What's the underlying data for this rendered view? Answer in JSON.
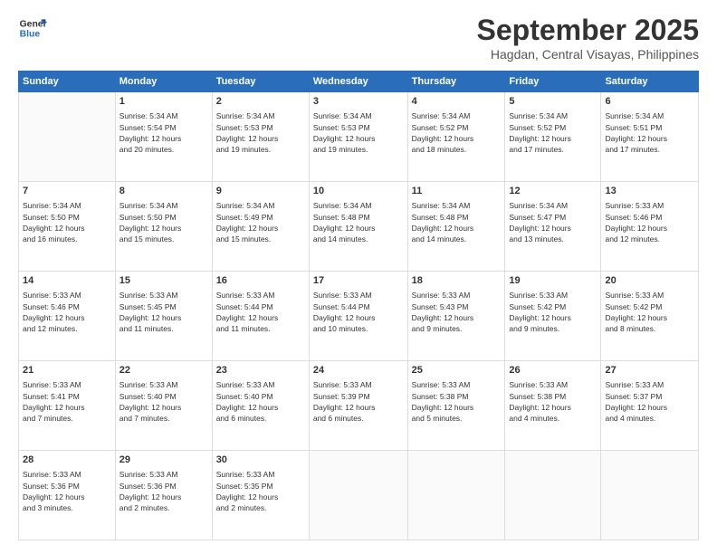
{
  "header": {
    "logo_line1": "General",
    "logo_line2": "Blue",
    "month": "September 2025",
    "location": "Hagdan, Central Visayas, Philippines"
  },
  "days_of_week": [
    "Sunday",
    "Monday",
    "Tuesday",
    "Wednesday",
    "Thursday",
    "Friday",
    "Saturday"
  ],
  "weeks": [
    [
      {
        "day": "",
        "info": ""
      },
      {
        "day": "1",
        "info": "Sunrise: 5:34 AM\nSunset: 5:54 PM\nDaylight: 12 hours\nand 20 minutes."
      },
      {
        "day": "2",
        "info": "Sunrise: 5:34 AM\nSunset: 5:53 PM\nDaylight: 12 hours\nand 19 minutes."
      },
      {
        "day": "3",
        "info": "Sunrise: 5:34 AM\nSunset: 5:53 PM\nDaylight: 12 hours\nand 19 minutes."
      },
      {
        "day": "4",
        "info": "Sunrise: 5:34 AM\nSunset: 5:52 PM\nDaylight: 12 hours\nand 18 minutes."
      },
      {
        "day": "5",
        "info": "Sunrise: 5:34 AM\nSunset: 5:52 PM\nDaylight: 12 hours\nand 17 minutes."
      },
      {
        "day": "6",
        "info": "Sunrise: 5:34 AM\nSunset: 5:51 PM\nDaylight: 12 hours\nand 17 minutes."
      }
    ],
    [
      {
        "day": "7",
        "info": "Sunrise: 5:34 AM\nSunset: 5:50 PM\nDaylight: 12 hours\nand 16 minutes."
      },
      {
        "day": "8",
        "info": "Sunrise: 5:34 AM\nSunset: 5:50 PM\nDaylight: 12 hours\nand 15 minutes."
      },
      {
        "day": "9",
        "info": "Sunrise: 5:34 AM\nSunset: 5:49 PM\nDaylight: 12 hours\nand 15 minutes."
      },
      {
        "day": "10",
        "info": "Sunrise: 5:34 AM\nSunset: 5:48 PM\nDaylight: 12 hours\nand 14 minutes."
      },
      {
        "day": "11",
        "info": "Sunrise: 5:34 AM\nSunset: 5:48 PM\nDaylight: 12 hours\nand 14 minutes."
      },
      {
        "day": "12",
        "info": "Sunrise: 5:34 AM\nSunset: 5:47 PM\nDaylight: 12 hours\nand 13 minutes."
      },
      {
        "day": "13",
        "info": "Sunrise: 5:33 AM\nSunset: 5:46 PM\nDaylight: 12 hours\nand 12 minutes."
      }
    ],
    [
      {
        "day": "14",
        "info": "Sunrise: 5:33 AM\nSunset: 5:46 PM\nDaylight: 12 hours\nand 12 minutes."
      },
      {
        "day": "15",
        "info": "Sunrise: 5:33 AM\nSunset: 5:45 PM\nDaylight: 12 hours\nand 11 minutes."
      },
      {
        "day": "16",
        "info": "Sunrise: 5:33 AM\nSunset: 5:44 PM\nDaylight: 12 hours\nand 11 minutes."
      },
      {
        "day": "17",
        "info": "Sunrise: 5:33 AM\nSunset: 5:44 PM\nDaylight: 12 hours\nand 10 minutes."
      },
      {
        "day": "18",
        "info": "Sunrise: 5:33 AM\nSunset: 5:43 PM\nDaylight: 12 hours\nand 9 minutes."
      },
      {
        "day": "19",
        "info": "Sunrise: 5:33 AM\nSunset: 5:42 PM\nDaylight: 12 hours\nand 9 minutes."
      },
      {
        "day": "20",
        "info": "Sunrise: 5:33 AM\nSunset: 5:42 PM\nDaylight: 12 hours\nand 8 minutes."
      }
    ],
    [
      {
        "day": "21",
        "info": "Sunrise: 5:33 AM\nSunset: 5:41 PM\nDaylight: 12 hours\nand 7 minutes."
      },
      {
        "day": "22",
        "info": "Sunrise: 5:33 AM\nSunset: 5:40 PM\nDaylight: 12 hours\nand 7 minutes."
      },
      {
        "day": "23",
        "info": "Sunrise: 5:33 AM\nSunset: 5:40 PM\nDaylight: 12 hours\nand 6 minutes."
      },
      {
        "day": "24",
        "info": "Sunrise: 5:33 AM\nSunset: 5:39 PM\nDaylight: 12 hours\nand 6 minutes."
      },
      {
        "day": "25",
        "info": "Sunrise: 5:33 AM\nSunset: 5:38 PM\nDaylight: 12 hours\nand 5 minutes."
      },
      {
        "day": "26",
        "info": "Sunrise: 5:33 AM\nSunset: 5:38 PM\nDaylight: 12 hours\nand 4 minutes."
      },
      {
        "day": "27",
        "info": "Sunrise: 5:33 AM\nSunset: 5:37 PM\nDaylight: 12 hours\nand 4 minutes."
      }
    ],
    [
      {
        "day": "28",
        "info": "Sunrise: 5:33 AM\nSunset: 5:36 PM\nDaylight: 12 hours\nand 3 minutes."
      },
      {
        "day": "29",
        "info": "Sunrise: 5:33 AM\nSunset: 5:36 PM\nDaylight: 12 hours\nand 2 minutes."
      },
      {
        "day": "30",
        "info": "Sunrise: 5:33 AM\nSunset: 5:35 PM\nDaylight: 12 hours\nand 2 minutes."
      },
      {
        "day": "",
        "info": ""
      },
      {
        "day": "",
        "info": ""
      },
      {
        "day": "",
        "info": ""
      },
      {
        "day": "",
        "info": ""
      }
    ]
  ]
}
